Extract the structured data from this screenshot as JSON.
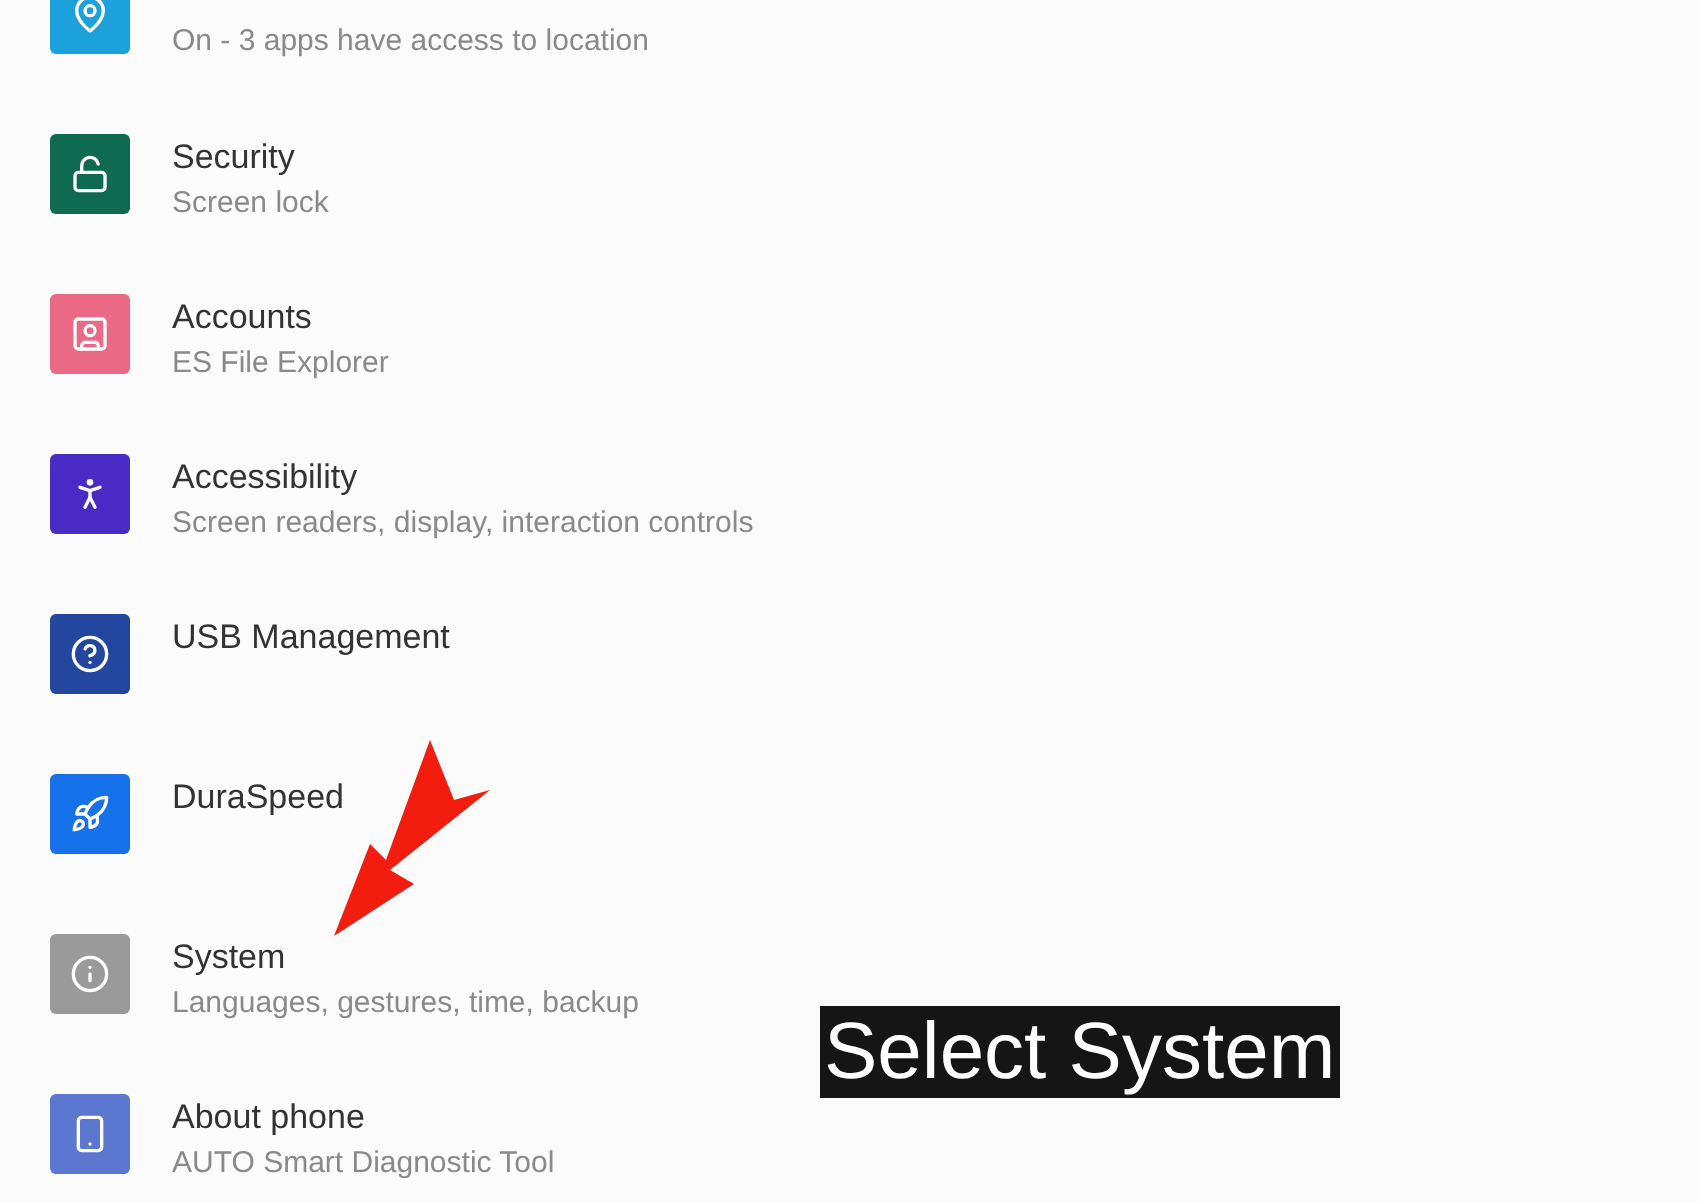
{
  "settings": [
    {
      "kind": "location",
      "color": "#1da1dc",
      "subtitle": "On - 3 apps have access to location"
    },
    {
      "kind": "security",
      "color": "#0e6b52",
      "title": "Security",
      "subtitle": "Screen lock"
    },
    {
      "kind": "accounts",
      "color": "#ea6a86",
      "title": "Accounts",
      "subtitle": "ES File Explorer"
    },
    {
      "kind": "accessibility",
      "color": "#4a2ac4",
      "title": "Accessibility",
      "subtitle": "Screen readers, display, interaction controls"
    },
    {
      "kind": "usb",
      "color": "#23479f",
      "title": "USB Management"
    },
    {
      "kind": "speed",
      "color": "#1672ea",
      "title": "DuraSpeed"
    },
    {
      "kind": "system",
      "color": "#9a9a9a",
      "title": "System",
      "subtitle": "Languages, gestures, time, backup"
    },
    {
      "kind": "about",
      "color": "#5c77cf",
      "title": "About phone",
      "subtitle": "AUTO Smart Diagnostic Tool"
    }
  ],
  "caption": "Select System"
}
